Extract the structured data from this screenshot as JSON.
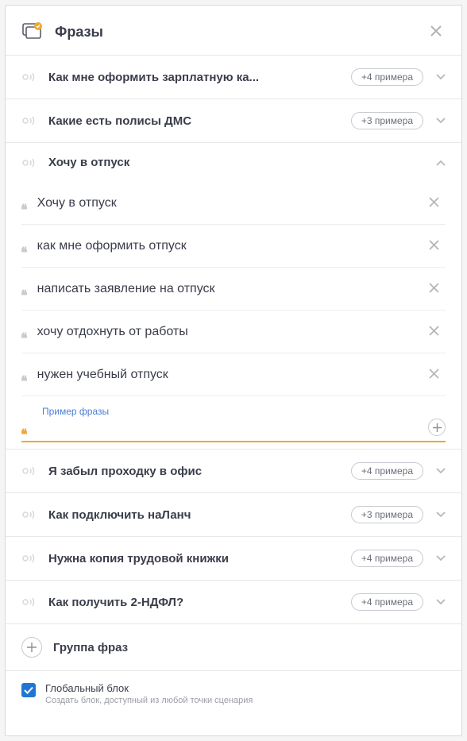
{
  "header": {
    "title": "Фразы"
  },
  "groups": [
    {
      "title": "Как мне оформить зарплатную ка...",
      "badge": "+4 примера",
      "expanded": false
    },
    {
      "title": "Какие есть полисы ДМС",
      "badge": "+3 примера",
      "expanded": false
    },
    {
      "title": "Хочу в отпуск",
      "badge": "",
      "expanded": true,
      "phrases": [
        "Хочу в отпуск",
        "как мне оформить отпуск",
        "написать заявление на отпуск",
        "хочу отдохнуть от работы",
        "нужен учебный отпуск"
      ],
      "input_label": "Пример фразы"
    },
    {
      "title": "Я забыл проходку в офис",
      "badge": "+4 примера",
      "expanded": false
    },
    {
      "title": "Как подключить наЛанч",
      "badge": "+3 примера",
      "expanded": false
    },
    {
      "title": "Нужна копия трудовой книжки",
      "badge": "+4 примера",
      "expanded": false
    },
    {
      "title": "Как получить 2-НДФЛ?",
      "badge": "+4 примера",
      "expanded": false
    }
  ],
  "add_group_label": "Группа фраз",
  "global": {
    "title": "Глобальный блок",
    "desc": "Создать блок, доступный из любой точки сценария"
  }
}
